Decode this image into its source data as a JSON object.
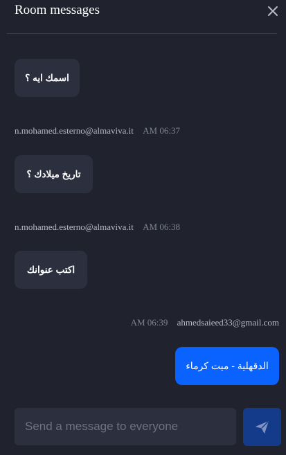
{
  "header": {
    "title": "Room messages",
    "close_icon": "close-icon"
  },
  "messages": [
    {
      "direction": "incoming",
      "text": "اسمك ايه ؟"
    },
    {
      "direction": "incoming",
      "sender": "n.mohamed.esterno@almaviva.it",
      "time": "AM 06:37",
      "text": "تاريخ ميلادك ؟"
    },
    {
      "direction": "incoming",
      "sender": "n.mohamed.esterno@almaviva.it",
      "time": "AM 06:38",
      "text": "اكتب عنوانك"
    },
    {
      "direction": "outgoing",
      "sender": "ahmedsaieed33@gmail.com",
      "time": "AM 06:39",
      "text": "الدقهلية - ميت كرماء"
    }
  ],
  "composer": {
    "placeholder": "Send a message to everyone",
    "value": "",
    "send_icon": "paper-plane-icon"
  },
  "colors": {
    "background": "#20232e",
    "incoming_bubble": "#2c2f3e",
    "outgoing_bubble": "#0a63fe",
    "send_button": "#143a8a"
  }
}
